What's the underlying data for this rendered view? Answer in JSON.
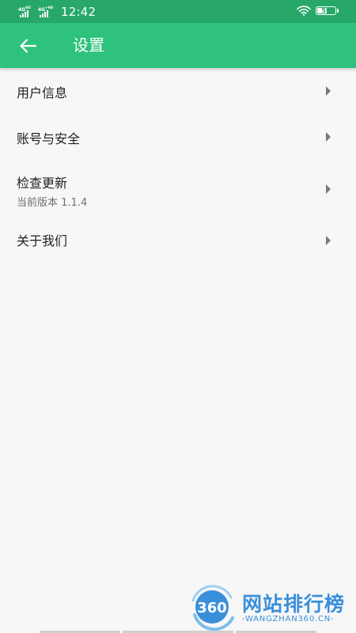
{
  "status_bar": {
    "net1": "4G",
    "net1_sup": "HD",
    "net2": "4G",
    "net2_sup": "+HD",
    "time": "12:42",
    "battery": "56",
    "battery_level": 0.56
  },
  "header": {
    "title": "设置",
    "back_icon": "arrow-left-icon"
  },
  "settings": {
    "items": [
      {
        "label": "用户信息",
        "icon": "chevron-right-icon"
      },
      {
        "label": "账号与安全",
        "icon": "chevron-right-icon"
      },
      {
        "label": "检查更新",
        "sublabel": "当前版本 1.1.4",
        "icon": "chevron-right-icon"
      },
      {
        "label": "关于我们",
        "icon": "chevron-right-icon"
      }
    ]
  },
  "watermark": {
    "badge": "360",
    "brand": "网站排行榜",
    "domain": "-WANGZHAN360.CN-"
  },
  "colors": {
    "status_bar": "#27a869",
    "app_bar": "#2ec27e",
    "background": "#f7f7f7",
    "watermark": "#3a8fdb"
  }
}
